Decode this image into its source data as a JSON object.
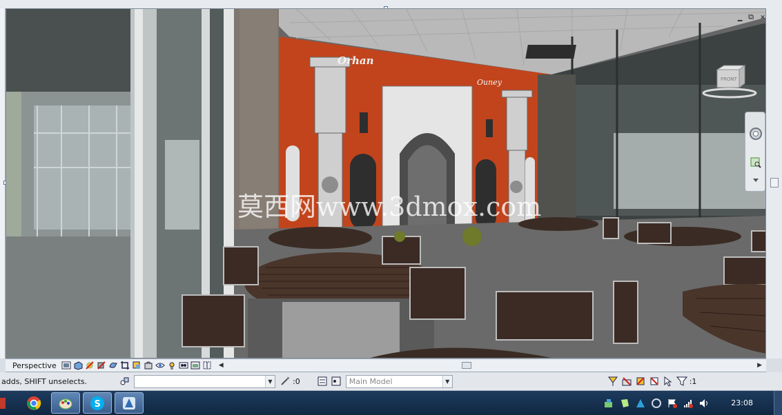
{
  "viewport": {
    "watermark": "莫西网www.3dmox.com",
    "signage": {
      "left_sign": "Orhan",
      "right_sign": "Ouney"
    },
    "viewcube_label": "FRONT"
  },
  "view_control": {
    "view_name": "Perspective",
    "icons": [
      "detail-level-icon",
      "visual-style-icon",
      "sun-path-icon",
      "shadows-icon",
      "render-icon",
      "crop-view-icon",
      "show-crop-icon",
      "unlock-3d-icon",
      "temporary-hide-icon",
      "reveal-hidden-icon",
      "temporary-view-properties-icon",
      "analytical-model-icon",
      "highlight-displacement-icon"
    ]
  },
  "status": {
    "message": "adds, SHIFT unselects.",
    "workset_value": "",
    "editable_count": ":0",
    "design_option": "Main Model",
    "filter_count": ":1"
  },
  "taskbar": {
    "buttons": [
      "chrome-icon",
      "paint-icon",
      "skype-icon",
      "revit-icon"
    ],
    "skype_letter": "S",
    "time": "23:08"
  },
  "colors": {
    "wall_orange": "#c2441c",
    "taskbar": "#1a3656",
    "accent": "#4f6fa8"
  }
}
